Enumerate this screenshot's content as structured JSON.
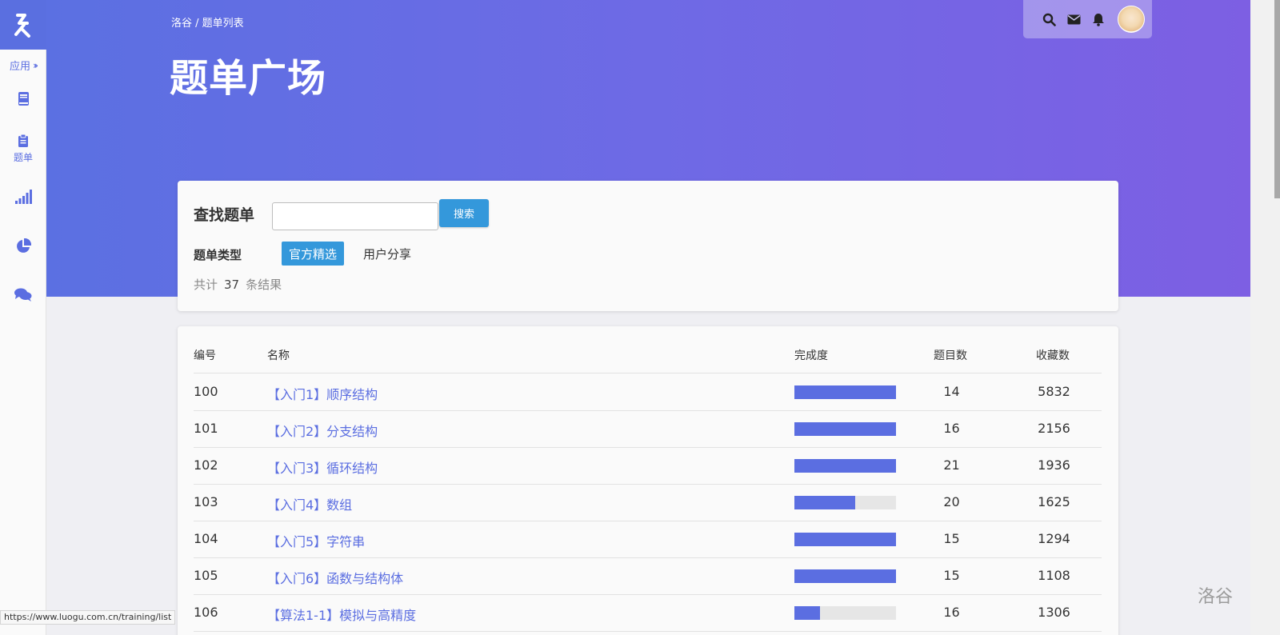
{
  "sidebar": {
    "apps_label": "应用",
    "items": [
      {
        "icon": "book-icon",
        "label": ""
      },
      {
        "icon": "clipboard-icon",
        "label": "题单"
      },
      {
        "icon": "signal-icon",
        "label": ""
      },
      {
        "icon": "pie-chart-icon",
        "label": ""
      },
      {
        "icon": "comments-icon",
        "label": ""
      }
    ]
  },
  "header": {
    "breadcrumb": "洛谷 / 题单列表",
    "title": "题单广场",
    "icons": [
      "search-icon",
      "mail-icon",
      "bell-icon",
      "avatar"
    ]
  },
  "search": {
    "title": "查找题单",
    "input_value": "",
    "button": "搜索",
    "type_label": "题单类型",
    "types": [
      "官方精选",
      "用户分享"
    ],
    "active_type": "官方精选",
    "count_prefix": "共计",
    "count": "37",
    "count_suffix": "条结果"
  },
  "table": {
    "headers": [
      "编号",
      "名称",
      "完成度",
      "题目数",
      "收藏数"
    ],
    "rows": [
      {
        "id": "100",
        "name": "【入门1】顺序结构",
        "progress": 1.0,
        "count": "14",
        "favs": "5832"
      },
      {
        "id": "101",
        "name": "【入门2】分支结构",
        "progress": 1.0,
        "count": "16",
        "favs": "2156"
      },
      {
        "id": "102",
        "name": "【入门3】循环结构",
        "progress": 1.0,
        "count": "21",
        "favs": "1936"
      },
      {
        "id": "103",
        "name": "【入门4】数组",
        "progress": 0.6,
        "count": "20",
        "favs": "1625"
      },
      {
        "id": "104",
        "name": "【入门5】字符串",
        "progress": 1.0,
        "count": "15",
        "favs": "1294"
      },
      {
        "id": "105",
        "name": "【入门6】函数与结构体",
        "progress": 1.0,
        "count": "15",
        "favs": "1108"
      },
      {
        "id": "106",
        "name": "【算法1-1】模拟与高精度",
        "progress": 0.25,
        "count": "16",
        "favs": "1306"
      }
    ]
  },
  "status_url": "https://www.luogu.com.cn/training/list",
  "watermark": "洛谷",
  "colors": {
    "accent": "#5b6ee1",
    "button": "#3498db",
    "banner_start": "#5b70e2",
    "banner_end": "#7d5fe3"
  }
}
